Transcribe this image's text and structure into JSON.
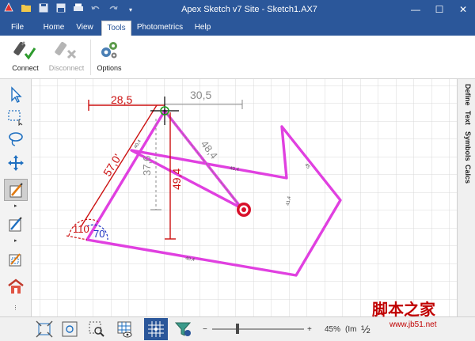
{
  "window": {
    "title": "Apex Sketch v7 Site - Sketch1.AX7",
    "quick_access": [
      "app-logo-icon",
      "open-icon",
      "save-icon",
      "save-as-icon",
      "print-icon",
      "undo-icon",
      "redo-icon",
      "customize-icon"
    ],
    "controls": {
      "minimize": "—",
      "maximize": "☐",
      "close": "✕"
    }
  },
  "ribbon": {
    "tabs": [
      {
        "label": "File",
        "active": false
      },
      {
        "label": "Home",
        "active": false
      },
      {
        "label": "View",
        "active": false
      },
      {
        "label": "Tools",
        "active": true
      },
      {
        "label": "Photometrics",
        "active": false
      },
      {
        "label": "Help",
        "active": false
      }
    ],
    "buttons": [
      {
        "label": "Connect",
        "icon": "connect-icon",
        "enabled": true
      },
      {
        "label": "Disconnect",
        "icon": "disconnect-icon",
        "enabled": false
      },
      {
        "label": "Options",
        "icon": "gears-icon",
        "enabled": true
      }
    ]
  },
  "left_tools": [
    {
      "name": "select-arrow-icon",
      "active": false
    },
    {
      "name": "rectangle-select-icon",
      "active": false
    },
    {
      "name": "lasso-icon",
      "active": false
    },
    {
      "name": "move-icon",
      "active": false
    },
    {
      "name": "draw-line-icon",
      "active": true
    },
    {
      "name": "draw-area-icon",
      "active": false
    },
    {
      "name": "resize-area-icon",
      "active": false
    },
    {
      "name": "building-icon",
      "active": false
    }
  ],
  "side_tabs": [
    "Define",
    "Text",
    "Symbols",
    "Calcs"
  ],
  "sketch": {
    "dimensions": {
      "top_left": "28,5",
      "top_right": "30,5",
      "vertical_left": "37,6",
      "vertical_right": "49,4",
      "diagonal_left": "57,0'",
      "diagonal_right": "48,4"
    },
    "angles": {
      "outer": "110",
      "inner": "70"
    },
    "small_labels": [
      "40,4",
      "41,4",
      "45",
      "40,4",
      "40,4"
    ],
    "colors": {
      "outline": "#e040e0",
      "dimension_red": "#cc1111",
      "dimension_gray": "#8a8a8a",
      "angle_blue": "#1a2fc0",
      "grid": "#d9d9d9"
    }
  },
  "statusbar": {
    "zoom": "45%",
    "zoom_suffix": "(Im",
    "zoom_more": "½",
    "zoom_minus": "−",
    "zoom_plus": "+",
    "tools": [
      "zoom-extents-icon",
      "zoom-fit-icon",
      "zoom-window-icon",
      "grid-view-icon",
      "grid-snap-icon",
      "filter-icon"
    ]
  },
  "watermark": {
    "text": "脚本之家",
    "url": "www.jb51.net"
  }
}
